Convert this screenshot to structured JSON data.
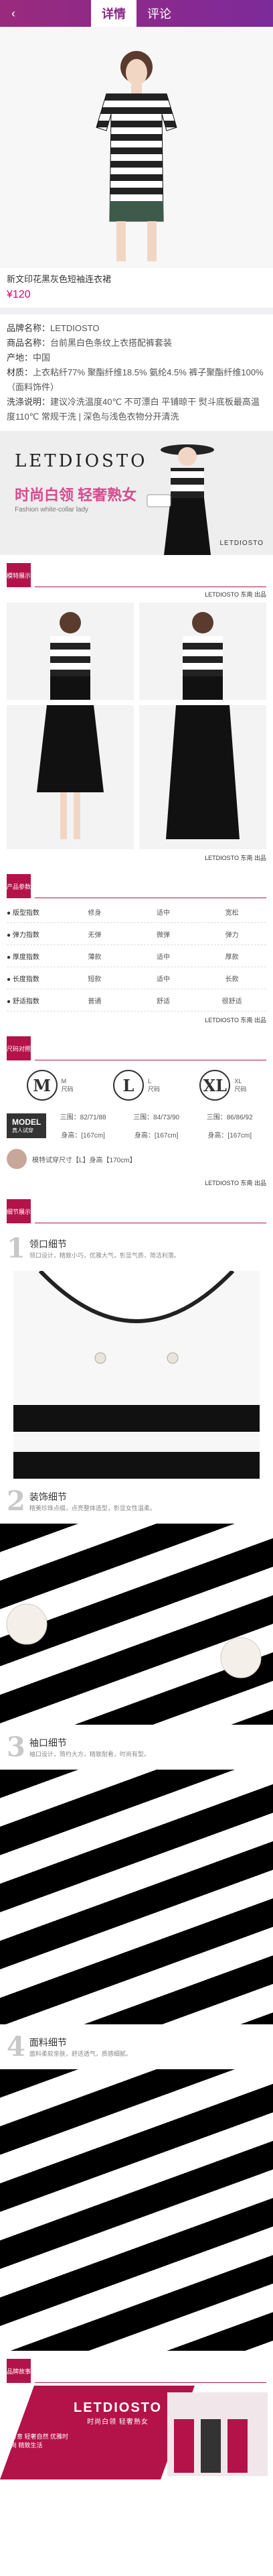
{
  "tabs": {
    "detail": "详情",
    "review": "评论"
  },
  "product": {
    "title": "新文印花黑灰色短袖连衣裙",
    "price": "¥120"
  },
  "spec": {
    "brand_label": "品牌名称：",
    "brand_value": "LETDIOSTO",
    "name_label": "商品名称：",
    "name_value": "台前黑白色条纹上衣搭配裤套装",
    "origin_label": "产地：",
    "origin_value": "中国",
    "material_label": "材质：",
    "material_value": "上衣粘纤77% 聚酯纤维18.5% 氨纶4.5% 裤子聚酯纤维100%（面料饰件）",
    "wash_label": "洗涤说明：",
    "wash_value": "建议冷洗温度40℃ 不可漂白 平铺晾干 熨斗底板最高温度110℃ 常规干洗 | 深色与浅色衣物分开清洗"
  },
  "banner": {
    "brand": "LETDIOSTO",
    "headline": "时尚白领 轻奢熟女",
    "subline": "Fashion white-collar lady",
    "logo": "LETDIOSTO"
  },
  "section_labels": {
    "display": "模特展示",
    "props": "产品参数",
    "size": "尺码对照",
    "details": "细节展示",
    "brand_story": "品牌故事"
  },
  "brand_caption": "LETDIOSTO 东南 出品",
  "props": {
    "headers": [
      "",
      "修身",
      "",
      "适中",
      "宽松"
    ],
    "rows": [
      {
        "name": "● 版型指数",
        "values": [
          "修身",
          "适中",
          "宽松"
        ]
      },
      {
        "name": "● 弹力指数",
        "values": [
          "无弹",
          "微弹",
          "弹力"
        ]
      },
      {
        "name": "● 厚度指数",
        "values": [
          "薄款",
          "适中",
          "厚款"
        ]
      },
      {
        "name": "● 长度指数",
        "values": [
          "短款",
          "适中",
          "长款"
        ]
      },
      {
        "name": "● 舒适指数",
        "values": [
          "普通",
          "舒适",
          "很舒适"
        ]
      }
    ]
  },
  "sizes": [
    {
      "letter": "M",
      "line1": "M",
      "line2": "尺码"
    },
    {
      "letter": "L",
      "line1": "L",
      "line2": "尺码"
    },
    {
      "letter": "XL",
      "line1": "XL",
      "line2": "尺码"
    }
  ],
  "model_info": {
    "label": "MODEL",
    "sub": "真人试穿",
    "dims": [
      "三围：82/71/88",
      "三围：84/73/90",
      "三围：86/86/92"
    ],
    "height": [
      "身高：[167cm]",
      "身高：[167cm]",
      "身高：[167cm]"
    ]
  },
  "review": {
    "text": "模特试穿尺寸【L】身高【170cm】"
  },
  "details": [
    {
      "num": "1",
      "title": "领口细节",
      "desc": "领口设计，精致小巧，优雅大气，彰显气质，简洁利落。"
    },
    {
      "num": "2",
      "title": "装饰细节",
      "desc": "精美珍珠点缀，点亮整体造型，彰显女性温柔。"
    },
    {
      "num": "3",
      "title": "袖口细节",
      "desc": "袖口设计，简约大方，精致耐看，时尚有型。"
    },
    {
      "num": "4",
      "title": "面料细节",
      "desc": "面料柔软亲肤，舒适透气，质感细腻。"
    }
  ],
  "brand_story": {
    "logo": "LETDIOSTO",
    "tagline": "时尚白领 轻奢熟女",
    "text": "写意 轻奢自然 优雅时尚 精致生活"
  }
}
